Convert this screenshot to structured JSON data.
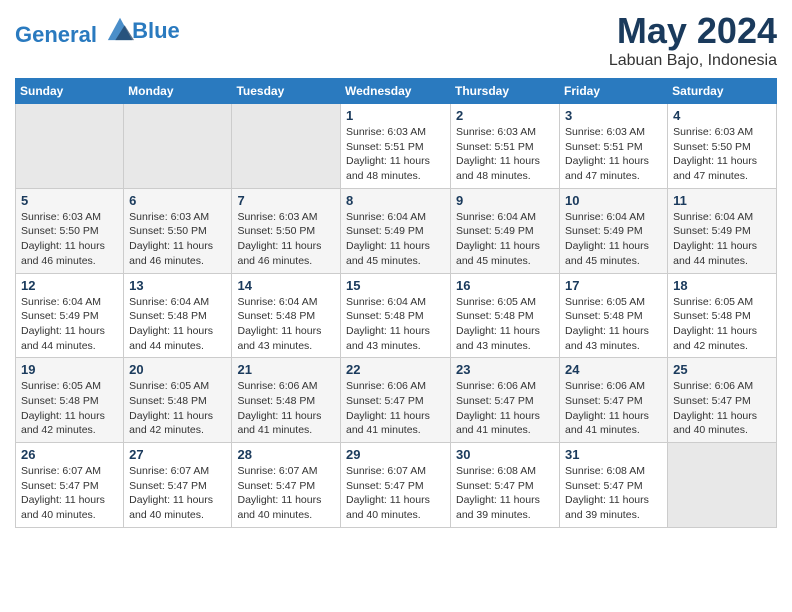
{
  "header": {
    "logo_line1": "General",
    "logo_line2": "Blue",
    "title": "May 2024",
    "subtitle": "Labuan Bajo, Indonesia"
  },
  "calendar": {
    "weekdays": [
      "Sunday",
      "Monday",
      "Tuesday",
      "Wednesday",
      "Thursday",
      "Friday",
      "Saturday"
    ],
    "weeks": [
      [
        {
          "day": "",
          "info": ""
        },
        {
          "day": "",
          "info": ""
        },
        {
          "day": "",
          "info": ""
        },
        {
          "day": "1",
          "info": "Sunrise: 6:03 AM\nSunset: 5:51 PM\nDaylight: 11 hours and 48 minutes."
        },
        {
          "day": "2",
          "info": "Sunrise: 6:03 AM\nSunset: 5:51 PM\nDaylight: 11 hours and 48 minutes."
        },
        {
          "day": "3",
          "info": "Sunrise: 6:03 AM\nSunset: 5:51 PM\nDaylight: 11 hours and 47 minutes."
        },
        {
          "day": "4",
          "info": "Sunrise: 6:03 AM\nSunset: 5:50 PM\nDaylight: 11 hours and 47 minutes."
        }
      ],
      [
        {
          "day": "5",
          "info": "Sunrise: 6:03 AM\nSunset: 5:50 PM\nDaylight: 11 hours and 46 minutes."
        },
        {
          "day": "6",
          "info": "Sunrise: 6:03 AM\nSunset: 5:50 PM\nDaylight: 11 hours and 46 minutes."
        },
        {
          "day": "7",
          "info": "Sunrise: 6:03 AM\nSunset: 5:50 PM\nDaylight: 11 hours and 46 minutes."
        },
        {
          "day": "8",
          "info": "Sunrise: 6:04 AM\nSunset: 5:49 PM\nDaylight: 11 hours and 45 minutes."
        },
        {
          "day": "9",
          "info": "Sunrise: 6:04 AM\nSunset: 5:49 PM\nDaylight: 11 hours and 45 minutes."
        },
        {
          "day": "10",
          "info": "Sunrise: 6:04 AM\nSunset: 5:49 PM\nDaylight: 11 hours and 45 minutes."
        },
        {
          "day": "11",
          "info": "Sunrise: 6:04 AM\nSunset: 5:49 PM\nDaylight: 11 hours and 44 minutes."
        }
      ],
      [
        {
          "day": "12",
          "info": "Sunrise: 6:04 AM\nSunset: 5:49 PM\nDaylight: 11 hours and 44 minutes."
        },
        {
          "day": "13",
          "info": "Sunrise: 6:04 AM\nSunset: 5:48 PM\nDaylight: 11 hours and 44 minutes."
        },
        {
          "day": "14",
          "info": "Sunrise: 6:04 AM\nSunset: 5:48 PM\nDaylight: 11 hours and 43 minutes."
        },
        {
          "day": "15",
          "info": "Sunrise: 6:04 AM\nSunset: 5:48 PM\nDaylight: 11 hours and 43 minutes."
        },
        {
          "day": "16",
          "info": "Sunrise: 6:05 AM\nSunset: 5:48 PM\nDaylight: 11 hours and 43 minutes."
        },
        {
          "day": "17",
          "info": "Sunrise: 6:05 AM\nSunset: 5:48 PM\nDaylight: 11 hours and 43 minutes."
        },
        {
          "day": "18",
          "info": "Sunrise: 6:05 AM\nSunset: 5:48 PM\nDaylight: 11 hours and 42 minutes."
        }
      ],
      [
        {
          "day": "19",
          "info": "Sunrise: 6:05 AM\nSunset: 5:48 PM\nDaylight: 11 hours and 42 minutes."
        },
        {
          "day": "20",
          "info": "Sunrise: 6:05 AM\nSunset: 5:48 PM\nDaylight: 11 hours and 42 minutes."
        },
        {
          "day": "21",
          "info": "Sunrise: 6:06 AM\nSunset: 5:48 PM\nDaylight: 11 hours and 41 minutes."
        },
        {
          "day": "22",
          "info": "Sunrise: 6:06 AM\nSunset: 5:47 PM\nDaylight: 11 hours and 41 minutes."
        },
        {
          "day": "23",
          "info": "Sunrise: 6:06 AM\nSunset: 5:47 PM\nDaylight: 11 hours and 41 minutes."
        },
        {
          "day": "24",
          "info": "Sunrise: 6:06 AM\nSunset: 5:47 PM\nDaylight: 11 hours and 41 minutes."
        },
        {
          "day": "25",
          "info": "Sunrise: 6:06 AM\nSunset: 5:47 PM\nDaylight: 11 hours and 40 minutes."
        }
      ],
      [
        {
          "day": "26",
          "info": "Sunrise: 6:07 AM\nSunset: 5:47 PM\nDaylight: 11 hours and 40 minutes."
        },
        {
          "day": "27",
          "info": "Sunrise: 6:07 AM\nSunset: 5:47 PM\nDaylight: 11 hours and 40 minutes."
        },
        {
          "day": "28",
          "info": "Sunrise: 6:07 AM\nSunset: 5:47 PM\nDaylight: 11 hours and 40 minutes."
        },
        {
          "day": "29",
          "info": "Sunrise: 6:07 AM\nSunset: 5:47 PM\nDaylight: 11 hours and 40 minutes."
        },
        {
          "day": "30",
          "info": "Sunrise: 6:08 AM\nSunset: 5:47 PM\nDaylight: 11 hours and 39 minutes."
        },
        {
          "day": "31",
          "info": "Sunrise: 6:08 AM\nSunset: 5:47 PM\nDaylight: 11 hours and 39 minutes."
        },
        {
          "day": "",
          "info": ""
        }
      ]
    ]
  }
}
